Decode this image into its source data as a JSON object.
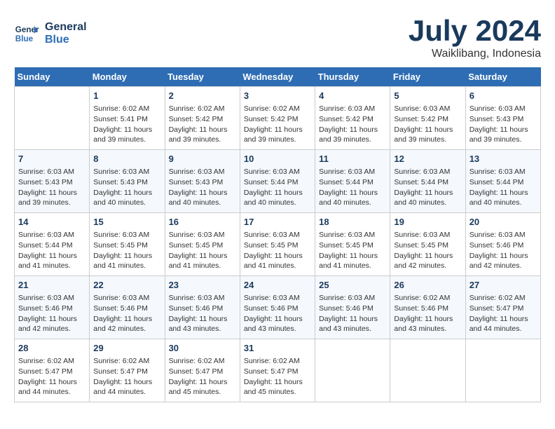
{
  "header": {
    "logo_line1": "General",
    "logo_line2": "Blue",
    "title": "July 2024",
    "subtitle": "Waiklibang, Indonesia"
  },
  "days_of_week": [
    "Sunday",
    "Monday",
    "Tuesday",
    "Wednesday",
    "Thursday",
    "Friday",
    "Saturday"
  ],
  "weeks": [
    [
      {
        "day": "",
        "sunrise": "",
        "sunset": "",
        "daylight": ""
      },
      {
        "day": "1",
        "sunrise": "Sunrise: 6:02 AM",
        "sunset": "Sunset: 5:41 PM",
        "daylight": "Daylight: 11 hours and 39 minutes."
      },
      {
        "day": "2",
        "sunrise": "Sunrise: 6:02 AM",
        "sunset": "Sunset: 5:42 PM",
        "daylight": "Daylight: 11 hours and 39 minutes."
      },
      {
        "day": "3",
        "sunrise": "Sunrise: 6:02 AM",
        "sunset": "Sunset: 5:42 PM",
        "daylight": "Daylight: 11 hours and 39 minutes."
      },
      {
        "day": "4",
        "sunrise": "Sunrise: 6:03 AM",
        "sunset": "Sunset: 5:42 PM",
        "daylight": "Daylight: 11 hours and 39 minutes."
      },
      {
        "day": "5",
        "sunrise": "Sunrise: 6:03 AM",
        "sunset": "Sunset: 5:42 PM",
        "daylight": "Daylight: 11 hours and 39 minutes."
      },
      {
        "day": "6",
        "sunrise": "Sunrise: 6:03 AM",
        "sunset": "Sunset: 5:43 PM",
        "daylight": "Daylight: 11 hours and 39 minutes."
      }
    ],
    [
      {
        "day": "7",
        "sunrise": "Sunrise: 6:03 AM",
        "sunset": "Sunset: 5:43 PM",
        "daylight": "Daylight: 11 hours and 39 minutes."
      },
      {
        "day": "8",
        "sunrise": "Sunrise: 6:03 AM",
        "sunset": "Sunset: 5:43 PM",
        "daylight": "Daylight: 11 hours and 40 minutes."
      },
      {
        "day": "9",
        "sunrise": "Sunrise: 6:03 AM",
        "sunset": "Sunset: 5:43 PM",
        "daylight": "Daylight: 11 hours and 40 minutes."
      },
      {
        "day": "10",
        "sunrise": "Sunrise: 6:03 AM",
        "sunset": "Sunset: 5:44 PM",
        "daylight": "Daylight: 11 hours and 40 minutes."
      },
      {
        "day": "11",
        "sunrise": "Sunrise: 6:03 AM",
        "sunset": "Sunset: 5:44 PM",
        "daylight": "Daylight: 11 hours and 40 minutes."
      },
      {
        "day": "12",
        "sunrise": "Sunrise: 6:03 AM",
        "sunset": "Sunset: 5:44 PM",
        "daylight": "Daylight: 11 hours and 40 minutes."
      },
      {
        "day": "13",
        "sunrise": "Sunrise: 6:03 AM",
        "sunset": "Sunset: 5:44 PM",
        "daylight": "Daylight: 11 hours and 40 minutes."
      }
    ],
    [
      {
        "day": "14",
        "sunrise": "Sunrise: 6:03 AM",
        "sunset": "Sunset: 5:44 PM",
        "daylight": "Daylight: 11 hours and 41 minutes."
      },
      {
        "day": "15",
        "sunrise": "Sunrise: 6:03 AM",
        "sunset": "Sunset: 5:45 PM",
        "daylight": "Daylight: 11 hours and 41 minutes."
      },
      {
        "day": "16",
        "sunrise": "Sunrise: 6:03 AM",
        "sunset": "Sunset: 5:45 PM",
        "daylight": "Daylight: 11 hours and 41 minutes."
      },
      {
        "day": "17",
        "sunrise": "Sunrise: 6:03 AM",
        "sunset": "Sunset: 5:45 PM",
        "daylight": "Daylight: 11 hours and 41 minutes."
      },
      {
        "day": "18",
        "sunrise": "Sunrise: 6:03 AM",
        "sunset": "Sunset: 5:45 PM",
        "daylight": "Daylight: 11 hours and 41 minutes."
      },
      {
        "day": "19",
        "sunrise": "Sunrise: 6:03 AM",
        "sunset": "Sunset: 5:45 PM",
        "daylight": "Daylight: 11 hours and 42 minutes."
      },
      {
        "day": "20",
        "sunrise": "Sunrise: 6:03 AM",
        "sunset": "Sunset: 5:46 PM",
        "daylight": "Daylight: 11 hours and 42 minutes."
      }
    ],
    [
      {
        "day": "21",
        "sunrise": "Sunrise: 6:03 AM",
        "sunset": "Sunset: 5:46 PM",
        "daylight": "Daylight: 11 hours and 42 minutes."
      },
      {
        "day": "22",
        "sunrise": "Sunrise: 6:03 AM",
        "sunset": "Sunset: 5:46 PM",
        "daylight": "Daylight: 11 hours and 42 minutes."
      },
      {
        "day": "23",
        "sunrise": "Sunrise: 6:03 AM",
        "sunset": "Sunset: 5:46 PM",
        "daylight": "Daylight: 11 hours and 43 minutes."
      },
      {
        "day": "24",
        "sunrise": "Sunrise: 6:03 AM",
        "sunset": "Sunset: 5:46 PM",
        "daylight": "Daylight: 11 hours and 43 minutes."
      },
      {
        "day": "25",
        "sunrise": "Sunrise: 6:03 AM",
        "sunset": "Sunset: 5:46 PM",
        "daylight": "Daylight: 11 hours and 43 minutes."
      },
      {
        "day": "26",
        "sunrise": "Sunrise: 6:02 AM",
        "sunset": "Sunset: 5:46 PM",
        "daylight": "Daylight: 11 hours and 43 minutes."
      },
      {
        "day": "27",
        "sunrise": "Sunrise: 6:02 AM",
        "sunset": "Sunset: 5:47 PM",
        "daylight": "Daylight: 11 hours and 44 minutes."
      }
    ],
    [
      {
        "day": "28",
        "sunrise": "Sunrise: 6:02 AM",
        "sunset": "Sunset: 5:47 PM",
        "daylight": "Daylight: 11 hours and 44 minutes."
      },
      {
        "day": "29",
        "sunrise": "Sunrise: 6:02 AM",
        "sunset": "Sunset: 5:47 PM",
        "daylight": "Daylight: 11 hours and 44 minutes."
      },
      {
        "day": "30",
        "sunrise": "Sunrise: 6:02 AM",
        "sunset": "Sunset: 5:47 PM",
        "daylight": "Daylight: 11 hours and 45 minutes."
      },
      {
        "day": "31",
        "sunrise": "Sunrise: 6:02 AM",
        "sunset": "Sunset: 5:47 PM",
        "daylight": "Daylight: 11 hours and 45 minutes."
      },
      {
        "day": "",
        "sunrise": "",
        "sunset": "",
        "daylight": ""
      },
      {
        "day": "",
        "sunrise": "",
        "sunset": "",
        "daylight": ""
      },
      {
        "day": "",
        "sunrise": "",
        "sunset": "",
        "daylight": ""
      }
    ]
  ]
}
